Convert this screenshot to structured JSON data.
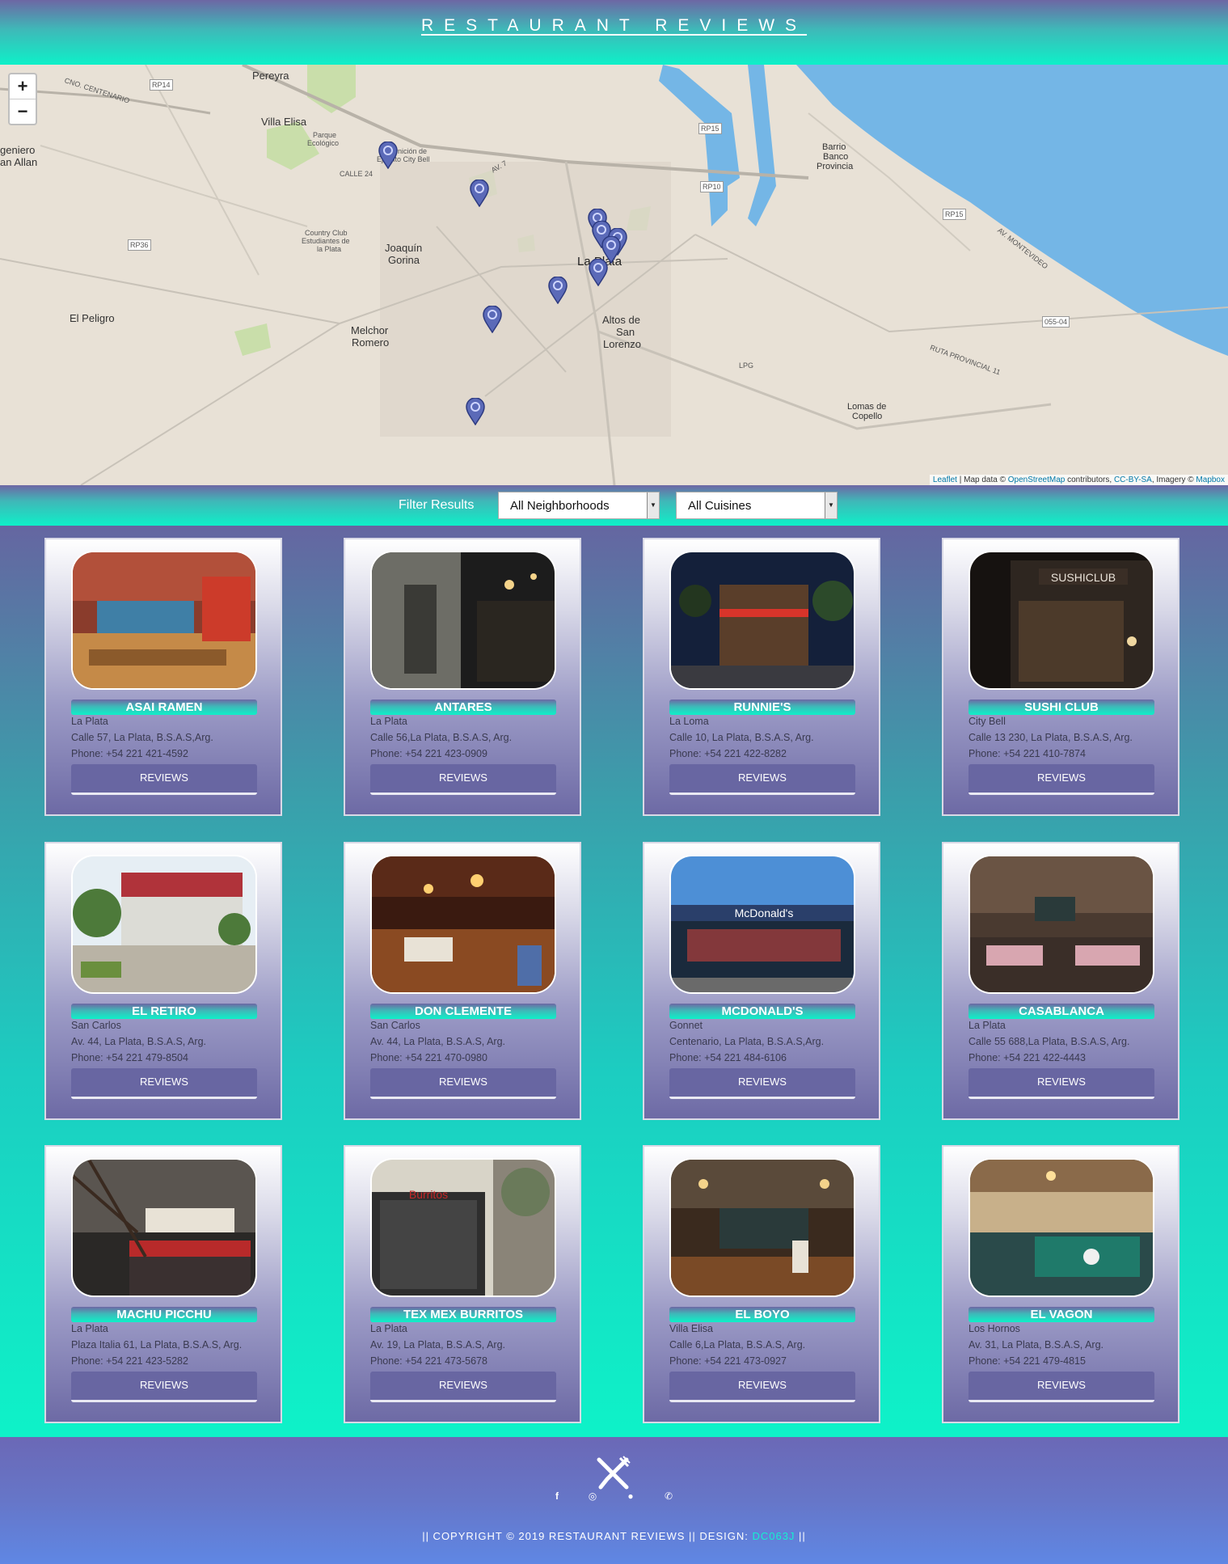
{
  "header": {
    "title": "RESTAURANT REVIEWS"
  },
  "map": {
    "zoom_in": "+",
    "zoom_out": "−",
    "attribution": {
      "leaflet": "Leaflet",
      "map_data": " | Map data © ",
      "osm": "OpenStreetMap",
      "contributors": " contributors, ",
      "license": "CC-BY-SA",
      "imagery": ", Imagery © ",
      "mapbox": "Mapbox"
    },
    "labels": {
      "pereyra": "Pereyra",
      "villa_elisa": "Villa Elisa",
      "ingeniero": "geniero",
      "allan": "an Allan",
      "joaquin": "Joaquín",
      "gorina": "Gorina",
      "melchor": "Melchor",
      "romero": "Romero",
      "la_plata": "La Plata",
      "altos": "Altos de",
      "san": "San",
      "lorenzo": "Lorenzo",
      "el_peligro": "El Peligro",
      "lomas": "Lomas de",
      "copello": "Copello",
      "barrio": "Barrio",
      "banco": "Banco",
      "provincia": "Provincia",
      "parque": "Parque",
      "ecologico": "Ecológico",
      "guarnicion": "Guarnición de",
      "ejercito": "Ejército City Bell",
      "country": "Country Club",
      "estudiantes": "Estudiantes de",
      "laplata_small": "la Plata",
      "rp14": "RP14",
      "rp15": "RP15",
      "rp10": "RP10",
      "rp36": "RP36",
      "lpg": "LPG",
      "r05504": "055-04",
      "cno": "CNO. CENTENARIO",
      "av7": "AV. 7",
      "calle24": "CALLE 24",
      "ruta11": "RUTA PROVINCIAL 11",
      "av_montevideo": "AV. MONTEVIDEO"
    }
  },
  "filter": {
    "label": "Filter Results",
    "neighborhoods": "All Neighborhoods",
    "cuisines": "All Cuisines"
  },
  "restaurants": [
    {
      "name": "ASAI RAMEN",
      "neighborhood": "La Plata",
      "address": "Calle 57, La Plata, B.S.A.S,Arg.",
      "phone": "Phone: +54 221 421-4592",
      "button": "REVIEWS"
    },
    {
      "name": "ANTARES",
      "neighborhood": "La Plata",
      "address": "Calle 56,La Plata, B.S.A.S, Arg.",
      "phone": "Phone: +54 221 423-0909",
      "button": "REVIEWS"
    },
    {
      "name": "RUNNIE'S",
      "neighborhood": "La Loma",
      "address": "Calle 10, La Plata, B.S.A.S, Arg.",
      "phone": "Phone: +54 221 422-8282",
      "button": "REVIEWS"
    },
    {
      "name": "SUSHI CLUB",
      "neighborhood": "City Bell",
      "address": "Calle 13 230, La Plata, B.S.A.S, Arg.",
      "phone": "Phone: +54 221 410-7874",
      "button": "REVIEWS"
    },
    {
      "name": "EL RETIRO",
      "neighborhood": "San Carlos",
      "address": "Av. 44, La Plata, B.S.A.S, Arg.",
      "phone": "Phone: +54 221 479-8504",
      "button": "REVIEWS"
    },
    {
      "name": "DON CLEMENTE",
      "neighborhood": "San Carlos",
      "address": "Av. 44, La Plata, B.S.A.S, Arg.",
      "phone": "Phone: +54 221 470-0980",
      "button": "REVIEWS"
    },
    {
      "name": "MCDONALD'S",
      "neighborhood": "Gonnet",
      "address": "Centenario, La Plata, B.S.A.S,Arg.",
      "phone": "Phone: +54 221 484-6106",
      "button": "REVIEWS"
    },
    {
      "name": "CASABLANCA",
      "neighborhood": "La Plata",
      "address": "Calle 55 688,La Plata, B.S.A.S, Arg.",
      "phone": "Phone: +54 221 422-4443",
      "button": "REVIEWS"
    },
    {
      "name": "MACHU PICCHU",
      "neighborhood": "La Plata",
      "address": "Plaza Italia 61, La Plata, B.S.A.S, Arg.",
      "phone": "Phone: +54 221 423-5282",
      "button": "REVIEWS"
    },
    {
      "name": "TEX MEX BURRITOS",
      "neighborhood": "La Plata",
      "address": "Av. 19, La Plata, B.S.A.S, Arg.",
      "phone": "Phone: +54 221 473-5678",
      "button": "REVIEWS"
    },
    {
      "name": "EL BOYO",
      "neighborhood": "Villa Elisa",
      "address": "Calle 6,La Plata, B.S.A.S, Arg.",
      "phone": "Phone: +54 221 473-0927",
      "button": "REVIEWS"
    },
    {
      "name": "EL VAGON",
      "neighborhood": "Los Hornos",
      "address": "Av. 31, La Plata, B.S.A.S, Arg.",
      "phone": "Phone: +54 221 479-4815",
      "button": "REVIEWS"
    }
  ],
  "footer": {
    "icons": [
      "facebook-icon",
      "instagram-icon",
      "github-icon",
      "whatsapp-icon"
    ],
    "copyright": "|| COPYRIGHT © 2019 RESTAURANT REVIEWS || DESIGN: ",
    "designer": "DC063J",
    "copyright_end": " ||"
  }
}
